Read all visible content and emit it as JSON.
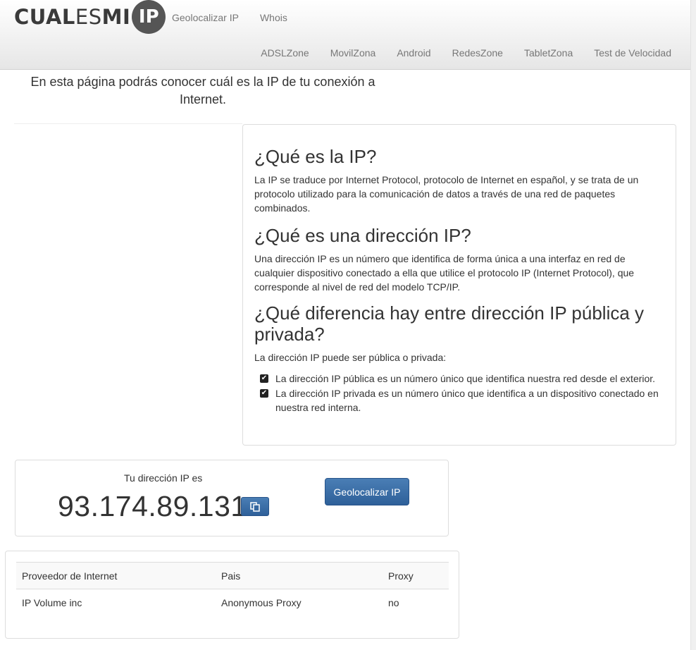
{
  "header": {
    "logo": {
      "part1": "CUAL",
      "part2": "ES",
      "part3": "MI",
      "circle": "IP"
    },
    "top_nav": [
      "Geolocalizar IP",
      "Whois"
    ],
    "secondary_nav": [
      "ADSLZone",
      "MovilZona",
      "Android",
      "RedesZone",
      "TabletZona",
      "Test de Velocidad"
    ]
  },
  "intro": "En esta página podrás conocer cuál es la IP de tu conexión a Internet.",
  "info": {
    "h1": "¿Qué es la IP?",
    "p1": "La IP se traduce por Internet Protocol, protocolo de Internet en español, y se trata de un protocolo utilizado para la comunicación de datos a través de una red de paquetes combinados.",
    "h2": "¿Qué es una dirección IP?",
    "p2": "Una dirección IP es un número que identifica de forma única a una interfaz en red de cualquier dispositivo conectado a ella que utilice el protocolo IP (Internet Protocol), que corresponde al nivel de red del modelo TCP/IP.",
    "h3": "¿Qué diferencia hay entre dirección IP pública y privada?",
    "p3": "La dirección IP puede ser pública o privada:",
    "list": [
      "La dirección IP pública es un número único que identifica nuestra red desde el exterior.",
      "La dirección IP privada es un número único que identifica a un dispositivo conectado en nuestra red interna."
    ]
  },
  "ip_box": {
    "label": "Tu dirección IP es",
    "ip": "93.174.89.131",
    "copy_icon": "copy-icon",
    "button": "Geolocalizar IP"
  },
  "table": {
    "headers": [
      "Proveedor de Internet",
      "Pais",
      "Proxy"
    ],
    "rows": [
      [
        "IP Volume inc",
        "Anonymous Proxy",
        "no"
      ]
    ]
  },
  "colors": {
    "accent": "#3a6ea5",
    "checkbox": "#222222"
  }
}
